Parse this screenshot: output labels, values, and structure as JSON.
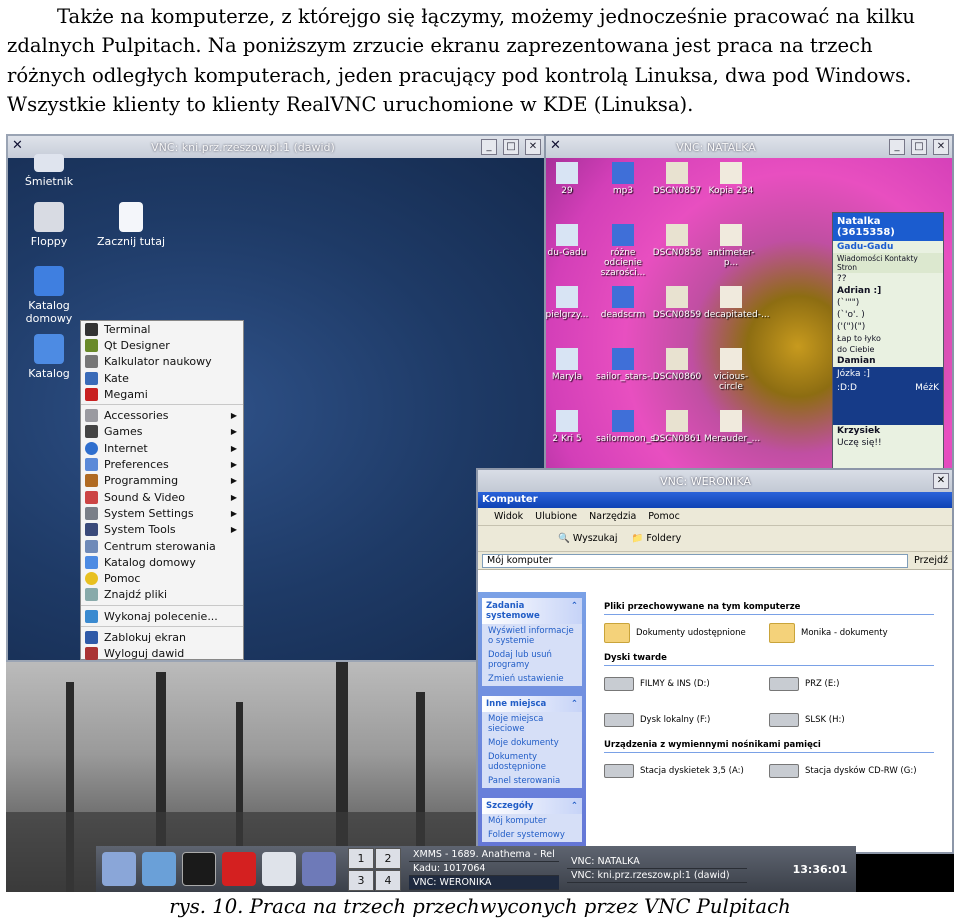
{
  "paragraph": {
    "line1": "Także na komputerze, z którejgo się łączymy, możemy jednocześnie pracować na kilku",
    "line2": "zdalnych Pulpitach. Na poniższym zrzucie ekranu zaprezentowana jest praca na trzech",
    "line3": "różnych odległych komputerach, jeden pracujący pod kontrolą Linuksa, dwa pod Windows.",
    "line4": "Wszystkie klienty to klienty RealVNC uruchomione w KDE (Linuksa)."
  },
  "kde_window": {
    "title": "VNC: kni.prz.rzeszow.pl:1 (dawid)",
    "desktop_icons": [
      "Śmietnik",
      "Floppy",
      "Zacznij tutaj",
      "Katalog domowy",
      "Katalog"
    ],
    "menu_items": [
      "Terminal",
      "Qt Designer",
      "Kalkulator naukowy",
      "Kate",
      "Megami",
      "Accessories",
      "Games",
      "Internet",
      "Preferences",
      "Programming",
      "Sound & Video",
      "System Settings",
      "System Tools",
      "Centrum sterowania",
      "Katalog domowy",
      "Pomoc",
      "Znajdź pliki",
      "Wykonaj polecenie...",
      "Zablokuj ekran",
      "Wyloguj dawid"
    ]
  },
  "natalka_window": {
    "title": "VNC: NATALKA",
    "icons": [
      "29",
      "mp3",
      "DSCN0857",
      "Kopia 234",
      "du-Gadu",
      "różne odcienie szarości...",
      "DSCN0858",
      "antimeter-p...",
      "pielgrzy...",
      "deadscrm",
      "DSCN0859",
      "decapitated-...",
      "Maryla",
      "sailor_stars-...",
      "DSCN0860",
      "vicious-circle",
      "2 Kri 5",
      "sailormoon_s...",
      "DSCN0861",
      "Merauder_..."
    ],
    "gadu": {
      "title": "Natalka (3615358)",
      "brand": "Gadu-Gadu",
      "toolbar": "Wiadomości  Kontakty  Stron",
      "entries": [
        "??",
        "Adrian :]",
        "(`'\"\")",
        "(`'o'. )",
        "('(\")(\")",
        "Łap to łyko",
        "do Ciebie",
        "Damian",
        "Józka :]",
        ":D:D",
        "MéżK",
        "Krzysiek",
        "Uczę się!!"
      ]
    }
  },
  "weronika_window": {
    "title": "VNC: WERONIKA",
    "xp_title": "Komputer",
    "menu": [
      "Widok",
      "Ulubione",
      "Narzędzia",
      "Pomoc"
    ],
    "toolbar": [
      "Wyszukaj",
      "Foldery"
    ],
    "address": "Mój komputer",
    "go": "Przejdź",
    "left_panels": [
      {
        "head": "Zadania systemowe",
        "items": [
          "Wyświetl informacje o systemie",
          "Dodaj lub usuń programy",
          "Zmień ustawienie"
        ]
      },
      {
        "head": "Inne miejsca",
        "items": [
          "Moje miejsca sieciowe",
          "Moje dokumenty",
          "Dokumenty udostępnione",
          "Panel sterowania"
        ]
      },
      {
        "head": "Szczegóły",
        "items": [
          "Mój komputer",
          "Folder systemowy"
        ]
      }
    ],
    "sections": [
      {
        "head": "Pliki przechowywane na tym komputerze",
        "items": [
          "Dokumenty udostępnione",
          "Monika - dokumenty"
        ]
      },
      {
        "head": "Dyski twarde",
        "items": [
          "FILMY & INS (D:)",
          "PRZ (E:)",
          "Dysk lokalny (F:)",
          "SLSK (H:)"
        ]
      },
      {
        "head": "Urządzenia z wymiennymi nośnikami pamięci",
        "items": [
          "Stacja dyskietek 3,5 (A:)",
          "Stacja dysków CD-RW (G:)"
        ]
      }
    ]
  },
  "panel": {
    "pager": [
      "1",
      "2",
      "3",
      "4"
    ],
    "tasks": [
      "XMMS - 1689. Anathema - Rel",
      "Kadu: 1017064",
      "VNC: WERONIKA",
      "VNC: NATALKA",
      "VNC: kni.prz.rzeszow.pl:1 (dawid)"
    ],
    "clock": "13:36:01"
  },
  "caption": "rys. 10. Praca na trzech przechwyconych przez VNC Pulpitach"
}
